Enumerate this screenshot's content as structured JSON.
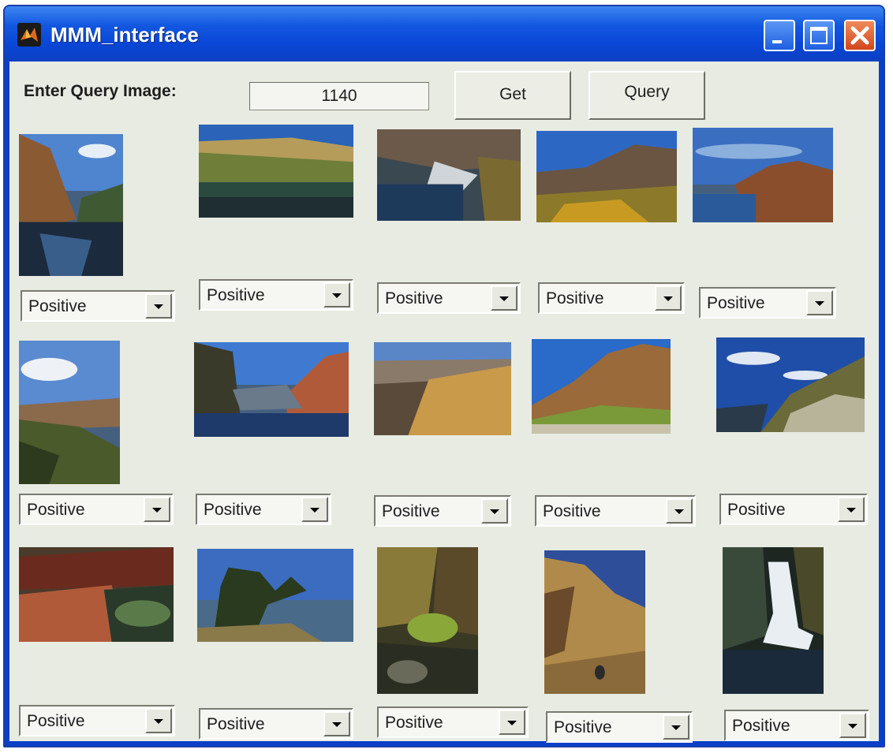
{
  "window": {
    "title": "MMM_interface",
    "controls": {
      "minimize": "minimize-icon",
      "maximize": "maximize-icon",
      "close": "close-icon"
    }
  },
  "query": {
    "label": "Enter Query Image:",
    "value": "1140",
    "get_label": "Get",
    "query_label": "Query"
  },
  "results": [
    {
      "scene": "canyon-river",
      "feedback": "Positive"
    },
    {
      "scene": "mesa-lake",
      "feedback": "Positive"
    },
    {
      "scene": "rocky-shore",
      "feedback": "Positive"
    },
    {
      "scene": "hillside-valley",
      "feedback": "Positive"
    },
    {
      "scene": "rock-island",
      "feedback": "Positive"
    },
    {
      "scene": "canyon-overlook",
      "feedback": "Positive"
    },
    {
      "scene": "river-gorge",
      "feedback": "Positive"
    },
    {
      "scene": "grand-canyon",
      "feedback": "Positive"
    },
    {
      "scene": "cliff-face",
      "feedback": "Positive"
    },
    {
      "scene": "sky-cliff",
      "feedback": "Positive"
    },
    {
      "scene": "red-rocks",
      "feedback": "Positive"
    },
    {
      "scene": "tree-overlook",
      "feedback": "Positive"
    },
    {
      "scene": "mossy-gorge",
      "feedback": "Positive"
    },
    {
      "scene": "desert-cliff",
      "feedback": "Positive"
    },
    {
      "scene": "waterfall",
      "feedback": "Positive"
    }
  ],
  "colors": {
    "titlebar": "#0a46d6",
    "face": "#e8ebe2",
    "close": "#d2461c"
  }
}
